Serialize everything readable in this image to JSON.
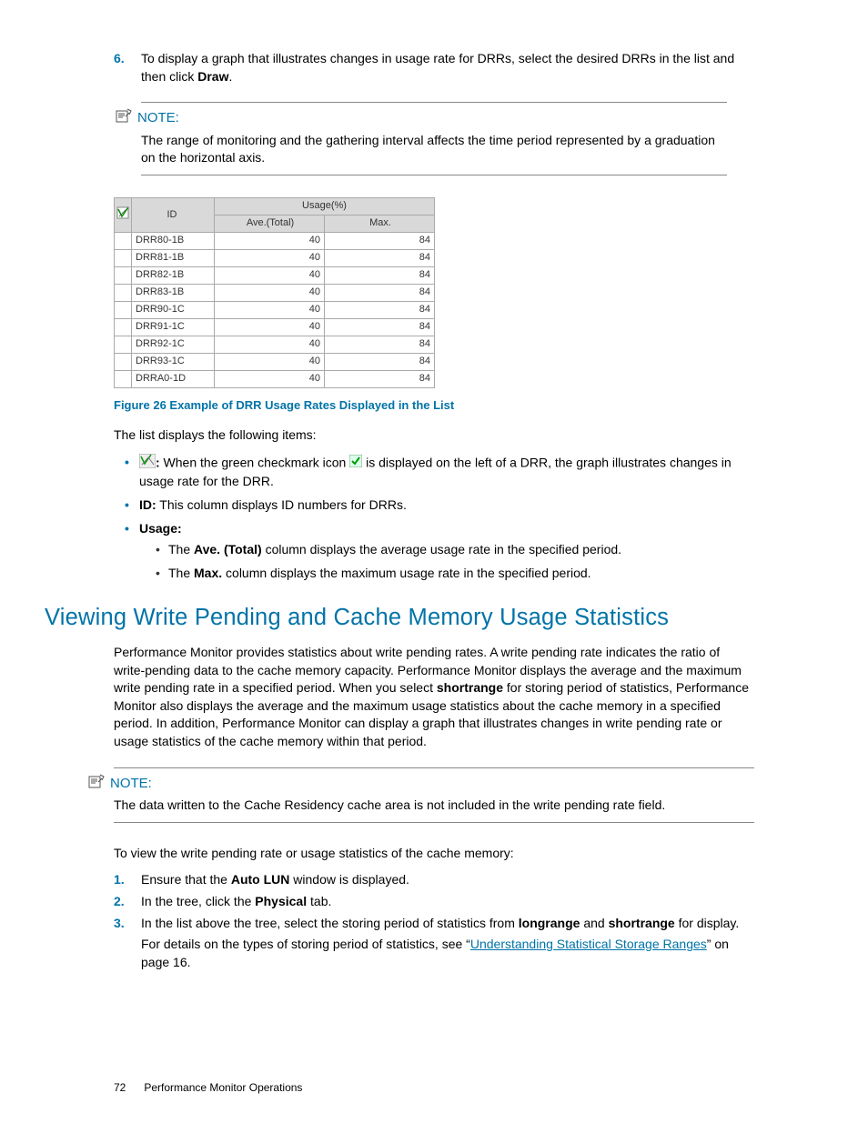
{
  "step6": {
    "num": "6.",
    "pre": "To display a graph that illustrates changes in usage rate for DRRs, select the desired DRRs in the list and then click ",
    "bold": "Draw",
    "post": "."
  },
  "note1": {
    "label": "NOTE:",
    "body": "The range of monitoring and the gathering interval affects the time period represented by a graduation on the horizontal axis."
  },
  "table": {
    "h_id": "ID",
    "h_usage": "Usage(%)",
    "h_ave": "Ave.(Total)",
    "h_max": "Max.",
    "rows": [
      {
        "id": "DRR80-1B",
        "ave": "40",
        "max": "84"
      },
      {
        "id": "DRR81-1B",
        "ave": "40",
        "max": "84"
      },
      {
        "id": "DRR82-1B",
        "ave": "40",
        "max": "84"
      },
      {
        "id": "DRR83-1B",
        "ave": "40",
        "max": "84"
      },
      {
        "id": "DRR90-1C",
        "ave": "40",
        "max": "84"
      },
      {
        "id": "DRR91-1C",
        "ave": "40",
        "max": "84"
      },
      {
        "id": "DRR92-1C",
        "ave": "40",
        "max": "84"
      },
      {
        "id": "DRR93-1C",
        "ave": "40",
        "max": "84"
      },
      {
        "id": "DRRA0-1D",
        "ave": "40",
        "max": "84"
      }
    ]
  },
  "figcap": "Figure 26 Example of DRR Usage Rates Displayed in the List",
  "list_intro": "The list displays the following items:",
  "bullets": {
    "b1_colon": ":",
    "b1_rest": " When the green checkmark icon ",
    "b1_rest2": " is displayed on the left of a DRR, the graph illustrates changes in usage rate for the DRR.",
    "b2_bold": "ID:",
    "b2_rest": " This column displays ID numbers for DRRs.",
    "b3_bold": "Usage:",
    "b3a_pre": "The ",
    "b3a_bold": "Ave. (Total)",
    "b3a_post": " column displays the average usage rate in the specified period.",
    "b3b_pre": "The ",
    "b3b_bold": "Max.",
    "b3b_post": " column displays the maximum usage rate in the specified period."
  },
  "heading": "Viewing Write Pending and Cache Memory Usage Statistics",
  "main_para_pre": "Performance Monitor provides statistics about write pending rates. A write pending rate indicates the ratio of write-pending data to the cache memory capacity. Performance Monitor displays the average and the maximum write pending rate in a specified period. When you select ",
  "main_para_b": "shortrange",
  "main_para_post": " for storing period of statistics, Performance Monitor also displays the average and the maximum usage statistics about the cache memory in a specified period. In addition, Performance Monitor can display a graph that illustrates changes in write pending rate or usage statistics of the cache memory within that period.",
  "note2": {
    "label": "NOTE:",
    "body": "The data written to the Cache Residency cache area is not included in the write pending rate field."
  },
  "para2": "To view the write pending rate or usage statistics of the cache memory:",
  "ol": {
    "i1": {
      "n": "1.",
      "pre": "Ensure that the ",
      "b": "Auto LUN",
      "post": " window is displayed."
    },
    "i2": {
      "n": "2.",
      "pre": "In the tree, click the ",
      "b": "Physical",
      "post": " tab."
    },
    "i3": {
      "n": "3.",
      "pre": "In the list above the tree, select the storing period of statistics from ",
      "b1": "longrange",
      "mid": " and ",
      "b2": "shortrange",
      "post": " for display.",
      "sub_pre": "For details on the types of storing period of statistics, see “",
      "sub_link": "Understanding Statistical Storage Ranges",
      "sub_post": "” on page 16."
    }
  },
  "footer": {
    "page": "72",
    "title": "Performance Monitor Operations"
  }
}
